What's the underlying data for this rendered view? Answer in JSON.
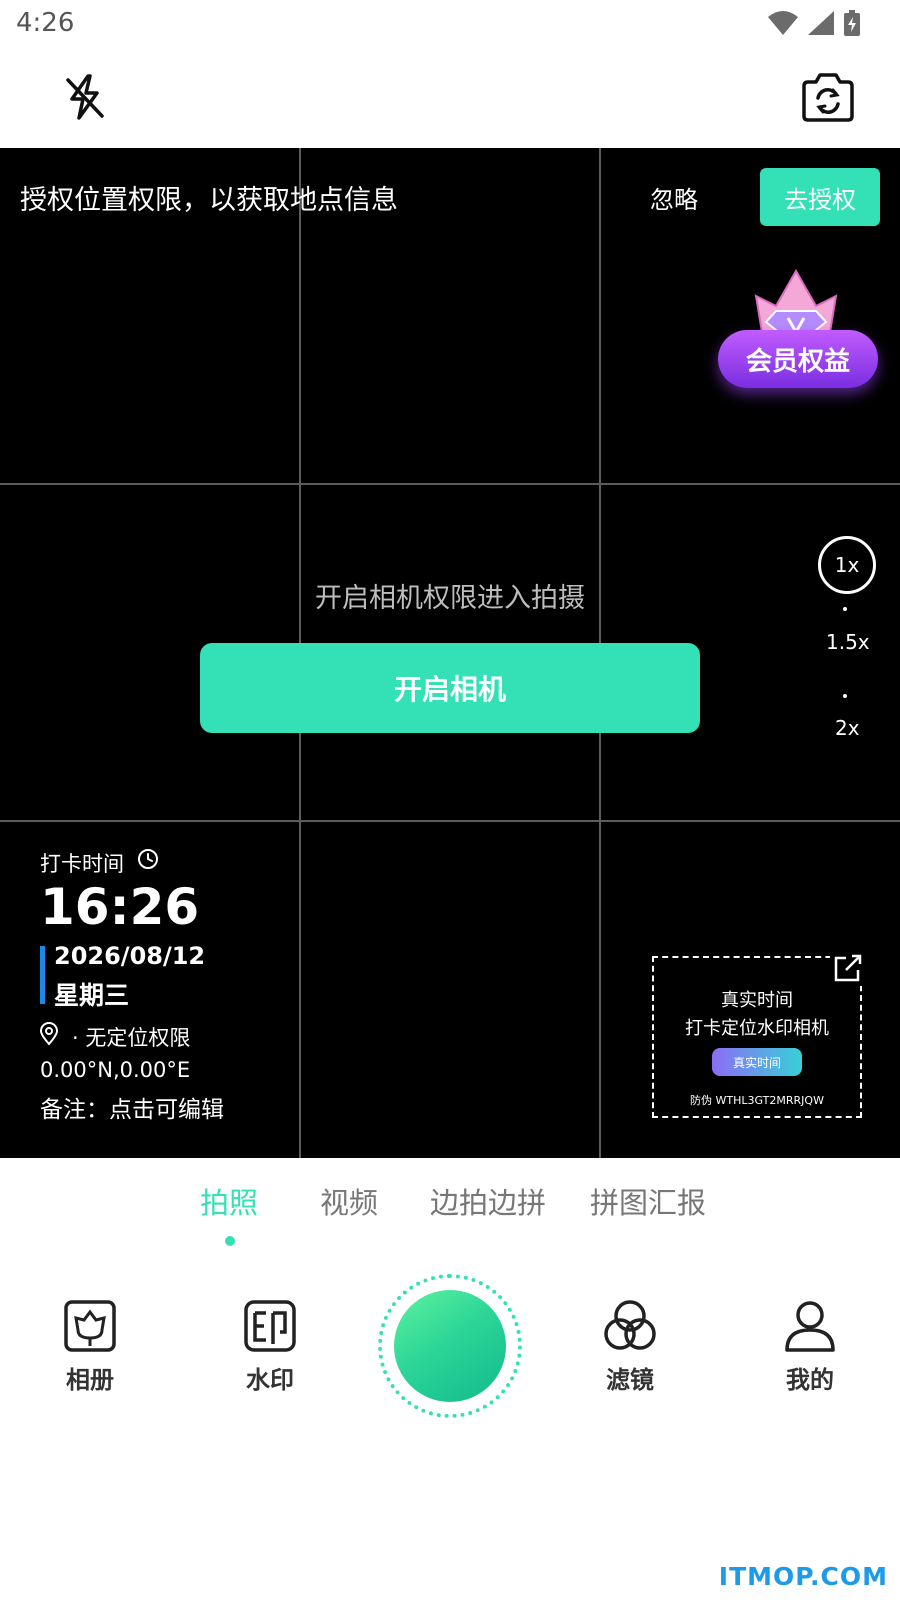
{
  "status_bar": {
    "time": "4:26",
    "icons": [
      "wifi-icon",
      "signal-icon",
      "battery-icon"
    ]
  },
  "top_bar": {
    "flash_icon": "flash-off-icon",
    "flip_icon": "camera-flip-icon"
  },
  "location_banner": {
    "text": "授权位置权限，以获取地点信息",
    "ignore_label": "忽略",
    "authorize_label": "去授权"
  },
  "vip_badge": {
    "label": "会员权益",
    "icon": "diamond-crown-icon"
  },
  "camera_permission": {
    "hint": "开启相机权限进入拍摄",
    "button_label": "开启相机"
  },
  "zoom": {
    "levels": [
      "1x",
      "1.5x",
      "2x"
    ],
    "selected": "1x"
  },
  "watermark_info": {
    "checkin_label": "打卡时间",
    "time": "16:26",
    "date": "2026/08/12",
    "weekday": "星期三",
    "location": "· 无定位权限",
    "coordinates": "0.00°N,0.00°E",
    "note": "备注：点击可编辑"
  },
  "watermark_preview": {
    "line1": "真实时间",
    "line2": "打卡定位水印相机",
    "chip_label": "真实时间",
    "code": "防伪 WTHL3GT2MRRJQW"
  },
  "mode_tabs": {
    "items": [
      "拍照",
      "视频",
      "边拍边拼",
      "拼图汇报"
    ],
    "active_index": 0
  },
  "bottom_nav": {
    "album_label": "相册",
    "watermark_label": "水印",
    "filter_label": "滤镜",
    "profile_label": "我的"
  },
  "site_logo": "ITMOP.COM",
  "colors": {
    "accent": "#34e1b6",
    "vip_purple": "#9b45f0",
    "date_bar": "#1e88e5"
  }
}
